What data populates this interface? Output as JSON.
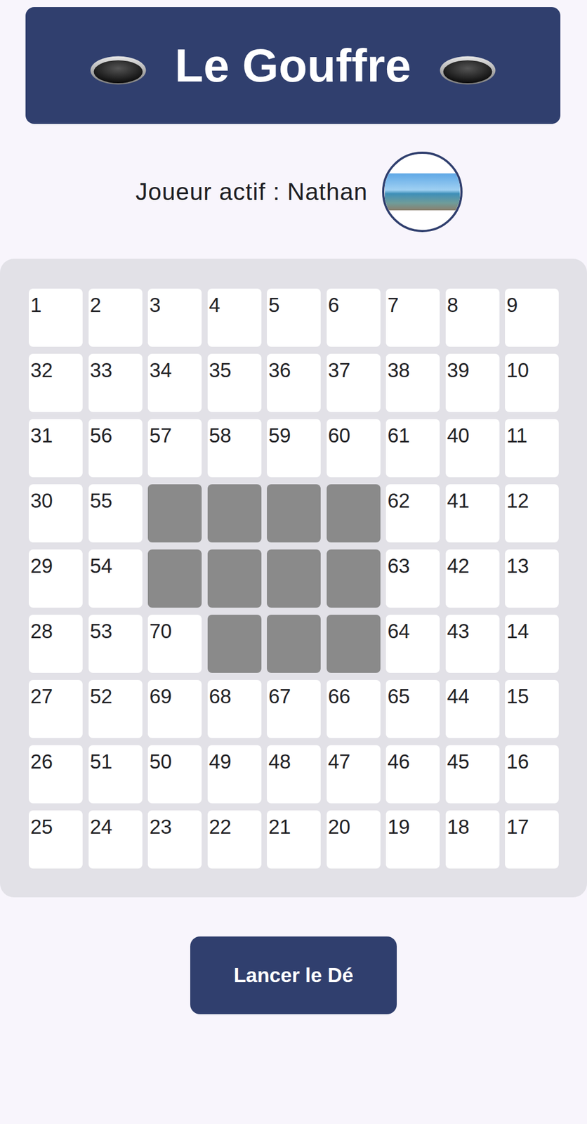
{
  "header": {
    "title": "Le Gouffre"
  },
  "player": {
    "label": "Joueur actif : Nathan"
  },
  "board": {
    "rows": [
      [
        {
          "kind": "square",
          "label": "1"
        },
        {
          "kind": "square",
          "label": "2"
        },
        {
          "kind": "square",
          "label": "3"
        },
        {
          "kind": "square",
          "label": "4"
        },
        {
          "kind": "square",
          "label": "5"
        },
        {
          "kind": "square",
          "label": "6"
        },
        {
          "kind": "square",
          "label": "7"
        },
        {
          "kind": "square",
          "label": "8"
        },
        {
          "kind": "square",
          "label": "9"
        }
      ],
      [
        {
          "kind": "square",
          "label": "32"
        },
        {
          "kind": "square",
          "label": "33"
        },
        {
          "kind": "square",
          "label": "34"
        },
        {
          "kind": "square",
          "label": "35"
        },
        {
          "kind": "square",
          "label": "36"
        },
        {
          "kind": "square",
          "label": "37"
        },
        {
          "kind": "square",
          "label": "38"
        },
        {
          "kind": "square",
          "label": "39"
        },
        {
          "kind": "square",
          "label": "10"
        }
      ],
      [
        {
          "kind": "square",
          "label": "31"
        },
        {
          "kind": "square",
          "label": "56"
        },
        {
          "kind": "square",
          "label": "57"
        },
        {
          "kind": "square",
          "label": "58"
        },
        {
          "kind": "square",
          "label": "59"
        },
        {
          "kind": "square",
          "label": "60"
        },
        {
          "kind": "square",
          "label": "61"
        },
        {
          "kind": "square",
          "label": "40"
        },
        {
          "kind": "square",
          "label": "11"
        }
      ],
      [
        {
          "kind": "square",
          "label": "30"
        },
        {
          "kind": "square",
          "label": "55"
        },
        {
          "kind": "gap"
        },
        {
          "kind": "gap"
        },
        {
          "kind": "gap"
        },
        {
          "kind": "gap"
        },
        {
          "kind": "square",
          "label": "62"
        },
        {
          "kind": "square",
          "label": "41"
        },
        {
          "kind": "square",
          "label": "12"
        }
      ],
      [
        {
          "kind": "square",
          "label": "29"
        },
        {
          "kind": "square",
          "label": "54"
        },
        {
          "kind": "gap"
        },
        {
          "kind": "gap"
        },
        {
          "kind": "gap"
        },
        {
          "kind": "gap"
        },
        {
          "kind": "square",
          "label": "63"
        },
        {
          "kind": "square",
          "label": "42"
        },
        {
          "kind": "square",
          "label": "13"
        }
      ],
      [
        {
          "kind": "square",
          "label": "28"
        },
        {
          "kind": "square",
          "label": "53"
        },
        {
          "kind": "square",
          "label": "70"
        },
        {
          "kind": "gap"
        },
        {
          "kind": "gap"
        },
        {
          "kind": "gap"
        },
        {
          "kind": "square",
          "label": "64"
        },
        {
          "kind": "square",
          "label": "43"
        },
        {
          "kind": "square",
          "label": "14"
        }
      ],
      [
        {
          "kind": "square",
          "label": "27"
        },
        {
          "kind": "square",
          "label": "52"
        },
        {
          "kind": "square",
          "label": "69"
        },
        {
          "kind": "square",
          "label": "68"
        },
        {
          "kind": "square",
          "label": "67"
        },
        {
          "kind": "square",
          "label": "66"
        },
        {
          "kind": "square",
          "label": "65"
        },
        {
          "kind": "square",
          "label": "44"
        },
        {
          "kind": "square",
          "label": "15"
        }
      ],
      [
        {
          "kind": "square",
          "label": "26"
        },
        {
          "kind": "square",
          "label": "51"
        },
        {
          "kind": "square",
          "label": "50"
        },
        {
          "kind": "square",
          "label": "49"
        },
        {
          "kind": "square",
          "label": "48"
        },
        {
          "kind": "square",
          "label": "47"
        },
        {
          "kind": "square",
          "label": "46"
        },
        {
          "kind": "square",
          "label": "45"
        },
        {
          "kind": "square",
          "label": "16"
        }
      ],
      [
        {
          "kind": "square",
          "label": "25"
        },
        {
          "kind": "square",
          "label": "24"
        },
        {
          "kind": "square",
          "label": "23"
        },
        {
          "kind": "square",
          "label": "22"
        },
        {
          "kind": "square",
          "label": "21"
        },
        {
          "kind": "square",
          "label": "20"
        },
        {
          "kind": "square",
          "label": "19"
        },
        {
          "kind": "square",
          "label": "18"
        },
        {
          "kind": "square",
          "label": "17"
        }
      ]
    ]
  },
  "buttons": [
    "Lancer le Dé"
  ]
}
